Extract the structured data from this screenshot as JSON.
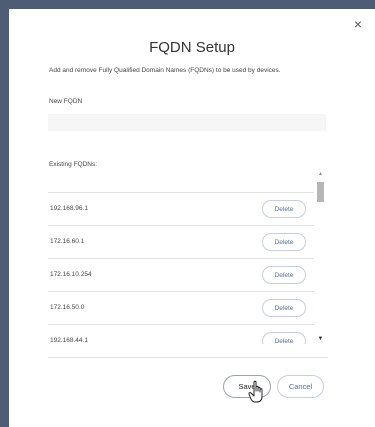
{
  "dialog": {
    "title": "FQDN Setup",
    "close_icon": "close-icon",
    "close_glyph": "×",
    "description": "Add and remove Fully Qualified Domain Names (FQDNs) to be used by devices.",
    "new_label": "New FQDN",
    "new_value": "",
    "new_placeholder": "",
    "existing_label": "Existing FQDNs:",
    "fqdns": [
      {
        "address": "192.168.96.1",
        "delete_label": "Delete"
      },
      {
        "address": "172.16.60.1",
        "delete_label": "Delete"
      },
      {
        "address": "172.16.10.254",
        "delete_label": "Delete"
      },
      {
        "address": "172.16.50.0",
        "delete_label": "Delete"
      },
      {
        "address": "192.168.44.1",
        "delete_label": "Delete"
      }
    ],
    "save_label": "Save",
    "cancel_label": "Cancel"
  },
  "colors": {
    "backdrop": "#4e5d73",
    "accent": "#5a6f99"
  },
  "icons": {
    "cursor": "hand-pointer-icon",
    "scroll_up": "scroll-up-icon",
    "scroll_down": "scroll-down-icon"
  }
}
